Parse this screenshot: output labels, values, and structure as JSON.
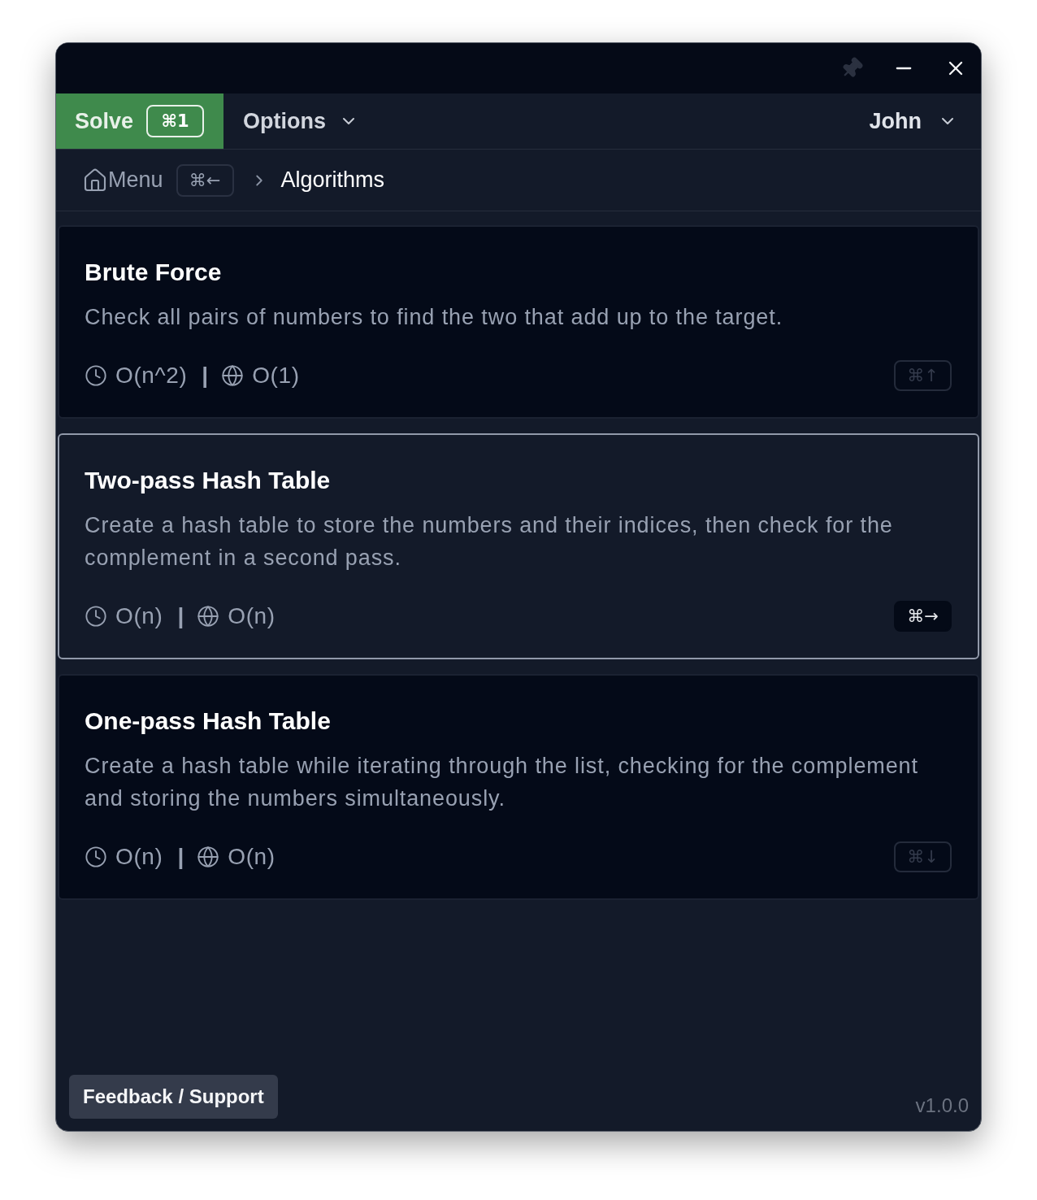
{
  "window": {
    "pinned": false
  },
  "nav": {
    "tabs": [
      {
        "label": "Solve",
        "shortcut": "⌘1",
        "has_menu": false,
        "selected": true
      },
      {
        "label": "Options",
        "has_menu": true,
        "selected": false
      }
    ],
    "user": {
      "name": "John",
      "has_menu": true
    }
  },
  "breadcrumb": [
    {
      "kind": "home",
      "label": "Menu",
      "shortcut": "⌘←",
      "current": false
    },
    {
      "kind": "page",
      "label": "Algorithms",
      "current": true
    }
  ],
  "approaches": [
    {
      "title": "Brute Force",
      "description": "Check all pairs of numbers to find the two that add up to the target.",
      "time": "O(n^2)",
      "separator": "|",
      "space": "O(1)",
      "shortcut": "⌘↑",
      "selected": false
    },
    {
      "title": "Two-pass Hash Table",
      "description": "Create a hash table to store the numbers and their indices, then check for the complement in a second pass.",
      "time": "O(n)",
      "separator": "|",
      "space": "O(n)",
      "shortcut": "⌘→",
      "selected": true
    },
    {
      "title": "One-pass Hash Table",
      "description": "Create a hash table while iterating through the list, checking for the complement and storing the numbers simultaneously.",
      "time": "O(n)",
      "separator": "|",
      "space": "O(n)",
      "shortcut": "⌘↓",
      "selected": false
    }
  ],
  "footer": {
    "button": "Feedback / Support",
    "version": "v1.0.0"
  }
}
